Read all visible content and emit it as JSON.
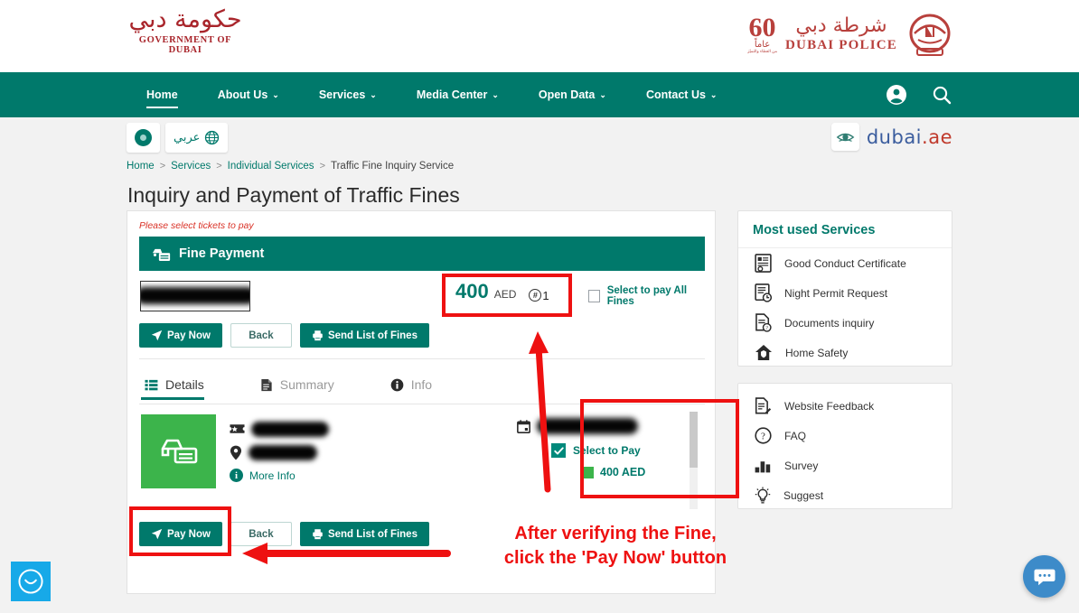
{
  "header": {
    "gov_logo_arabic": "حكومة دبي",
    "gov_logo_en": "GOVERNMENT OF DUBAI",
    "police_60": "60",
    "police_60_arabic": "عاماً",
    "police_60_sub": "من العطاء والتميّز",
    "police_arabic": "شرطة دبي",
    "police_en": "DUBAI POLICE"
  },
  "nav": {
    "items": [
      {
        "label": "Home",
        "has_caret": false,
        "active": true
      },
      {
        "label": "About Us",
        "has_caret": true,
        "active": false
      },
      {
        "label": "Services",
        "has_caret": true,
        "active": false
      },
      {
        "label": "Media Center",
        "has_caret": true,
        "active": false
      },
      {
        "label": "Open Data",
        "has_caret": true,
        "active": false
      },
      {
        "label": "Contact Us",
        "has_caret": true,
        "active": false
      }
    ],
    "caret": "⌄",
    "account_icon": "account-circle-icon",
    "search_icon": "search-icon"
  },
  "subbar": {
    "accessibility_icon": "accessibility-toggle-icon",
    "lang_label": "عربي",
    "globe_icon": "globe-icon",
    "portal_eye_icon": "dubai-ae-eye-icon",
    "portal_name_1": "dubai",
    "portal_name_2": ".ae"
  },
  "breadcrumb": {
    "sep": ">",
    "items": [
      {
        "label": "Home",
        "link": true
      },
      {
        "label": "Services",
        "link": true
      },
      {
        "label": "Individual Services",
        "link": true
      },
      {
        "label": "Traffic Fine Inquiry Service",
        "link": false
      }
    ]
  },
  "page": {
    "title": "Inquiry and Payment of Traffic Fines"
  },
  "panel": {
    "note": "Please select tickets to pay",
    "fine_header": "Fine Payment",
    "fine_header_icon": "car-payment-icon",
    "plate_value": "",
    "amount_value": "400",
    "amount_currency": "AED",
    "count_hash": "#",
    "count_value": "1",
    "select_all_label": "Select to pay All Fines",
    "select_all_checked": false,
    "buttons": {
      "pay_now": "Pay Now",
      "pay_now_icon": "send-plane-icon",
      "back": "Back",
      "send_list": "Send List of Fines",
      "send_list_icon": "printer-icon"
    },
    "tabs": [
      {
        "label": "Details",
        "icon": "list-details-icon",
        "active": true
      },
      {
        "label": "Summary",
        "icon": "document-icon",
        "active": false
      },
      {
        "label": "Info",
        "icon": "info-circle-icon",
        "active": false
      }
    ],
    "fine_card": {
      "vehicle_icon": "car-ticket-icon",
      "ticket_icon": "ticket-icon",
      "ticket_value": "",
      "location_icon": "map-pin-icon",
      "location_value": "",
      "more_info_label": "More Info",
      "more_info_icon": "info-circle-icon",
      "date_icon": "calendar-icon",
      "date_value": "",
      "select_to_pay_label": "Select to Pay",
      "select_to_pay_checked": true,
      "check_glyph": "✔",
      "amount_label": "400 AED"
    }
  },
  "sidebar": {
    "most_used_title": "Most used Services",
    "most_used_items": [
      {
        "label": "Good Conduct Certificate",
        "icon": "certificate-document-icon"
      },
      {
        "label": "Night Permit Request",
        "icon": "document-clock-icon"
      },
      {
        "label": "Documents inquiry",
        "icon": "document-question-icon"
      },
      {
        "label": "Home Safety",
        "icon": "home-shield-icon"
      }
    ],
    "feedback_items": [
      {
        "label": "Website Feedback",
        "icon": "document-pencil-icon"
      },
      {
        "label": "FAQ",
        "icon": "question-circle-icon"
      },
      {
        "label": "Survey",
        "icon": "bar-chart-icon"
      },
      {
        "label": "Suggest",
        "icon": "lightbulb-icon"
      }
    ]
  },
  "widgets": {
    "smiley_icon": "happiness-meter-smiley-icon",
    "chat_icon": "chat-bubble-icon"
  },
  "annotations": {
    "instruction_line_1": "After verifying the Fine,",
    "instruction_line_2": "click the 'Pay Now' button",
    "highlight_color": "#ee1111"
  }
}
